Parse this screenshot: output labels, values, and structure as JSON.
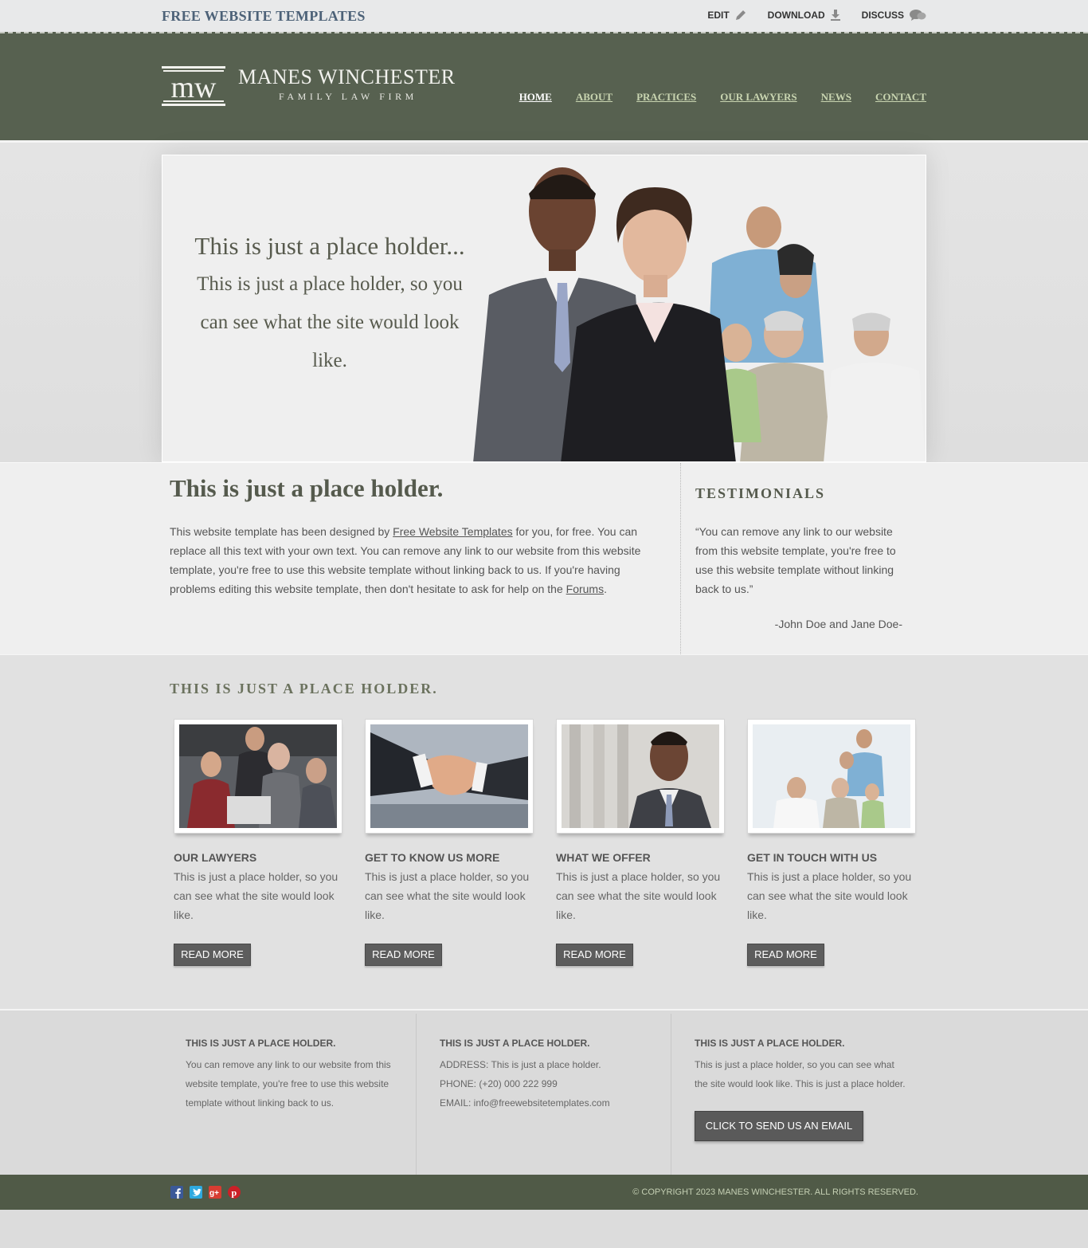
{
  "topbar": {
    "brand": "FREE WEBSITE TEMPLATES",
    "links": [
      "EDIT",
      "DOWNLOAD",
      "DISCUSS"
    ]
  },
  "header": {
    "logo_name": "MANES WINCHESTER",
    "logo_sub": "FAMILY LAW FIRM",
    "nav": [
      "HOME",
      "ABOUT",
      "PRACTICES",
      "OUR LAWYERS",
      "NEWS",
      "CONTACT"
    ],
    "active": "HOME"
  },
  "hero": {
    "line1": "This is just a place holder...",
    "line2": "This is just a place holder, so you can see what the site would look like."
  },
  "main": {
    "title": "This is just a place holder.",
    "para_a": "This website template has been designed by ",
    "link1": "Free Website Templates",
    "para_b": " for you, for free. You can replace all this text with your own text. You can remove any link to our website from this website template, you're free to use this website template without linking back to us. If you're having problems editing this website template, then don't hesitate to ask for help on the ",
    "link2": "Forums",
    "para_c": "."
  },
  "testimonials": {
    "title": "TESTIMONIALS",
    "quote": "“You can remove any link to our website from this website template, you're free to use this website template without linking back to us.”",
    "author": "-John Doe and Jane Doe-"
  },
  "features": {
    "title": "THIS IS JUST A PLACE HOLDER.",
    "cards": [
      {
        "heading": "OUR LAWYERS",
        "text": "This is just a place holder, so you can see what the site would look like.",
        "button": "READ MORE"
      },
      {
        "heading": "GET TO KNOW US MORE",
        "text": "This is just a place holder, so you can see what the site would look like.",
        "button": "READ MORE"
      },
      {
        "heading": "WHAT WE OFFER",
        "text": "This is just a place holder, so you can see what the site would look like.",
        "button": "READ MORE"
      },
      {
        "heading": "GET IN TOUCH WITH US",
        "text": "This is just a place holder, so you can see what the site would look like.",
        "button": "READ MORE"
      }
    ]
  },
  "footer": {
    "cols": [
      {
        "heading": "THIS IS JUST A PLACE HOLDER.",
        "text": "You can remove any link to our website from this website template, you're free to use this website template without linking back to us."
      },
      {
        "heading": "THIS IS JUST A PLACE HOLDER.",
        "lines": [
          "ADDRESS: This is just a place holder.",
          "PHONE: (+20) 000 222 999",
          "EMAIL: info@freewebsitetemplates.com"
        ]
      },
      {
        "heading": "THIS IS JUST A PLACE HOLDER.",
        "text": "This is just a place holder, so you can see what the site would look like. This is just a place holder.",
        "button": "CLICK TO SEND US AN EMAIL"
      }
    ],
    "socials": [
      "facebook-icon",
      "twitter-icon",
      "googleplus-icon",
      "pinterest-icon"
    ],
    "copyright": "© COPYRIGHT 2023 MANES WINCHESTER. ALL RIGHTS RESERVED."
  },
  "colors": {
    "header_bg": "#576150",
    "bottombar_bg": "#505a47",
    "nav_link": "#c8d4b0",
    "button_bg": "#5d5d5d",
    "brand_blue": "#4d6278"
  }
}
